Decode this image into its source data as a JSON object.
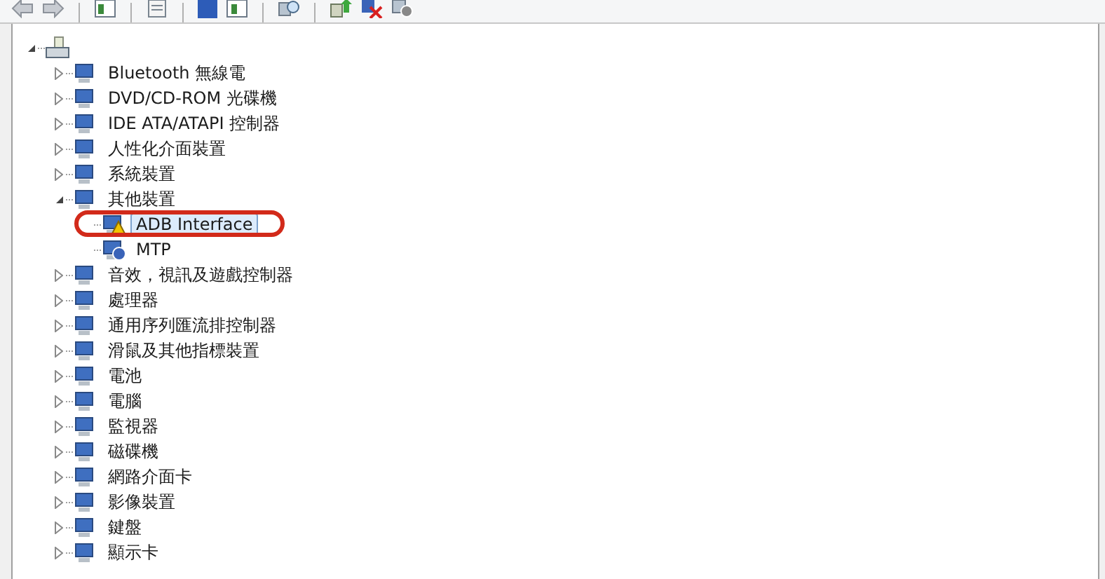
{
  "tree": {
    "expanded": true,
    "children": [
      {
        "label": "Bluetooth 無線電",
        "expanded": false,
        "selected": false
      },
      {
        "label": "DVD/CD-ROM 光碟機",
        "expanded": false,
        "selected": false
      },
      {
        "label": "IDE ATA/ATAPI 控制器",
        "expanded": false,
        "selected": false
      },
      {
        "label": "人性化介面裝置",
        "expanded": false,
        "selected": false
      },
      {
        "label": "系統裝置",
        "expanded": false,
        "selected": false
      },
      {
        "label": "其他裝置",
        "expanded": true,
        "selected": false,
        "children": [
          {
            "label": "ADB Interface",
            "selected": true,
            "warning": true,
            "circled": true
          },
          {
            "label": "MTP",
            "selected": false,
            "unknown": true
          }
        ]
      },
      {
        "label": "音效，視訊及遊戲控制器",
        "expanded": false,
        "selected": false
      },
      {
        "label": "處理器",
        "expanded": false,
        "selected": false
      },
      {
        "label": "通用序列匯流排控制器",
        "expanded": false,
        "selected": false
      },
      {
        "label": "滑鼠及其他指標裝置",
        "expanded": false,
        "selected": false
      },
      {
        "label": "電池",
        "expanded": false,
        "selected": false
      },
      {
        "label": "電腦",
        "expanded": false,
        "selected": false
      },
      {
        "label": "監視器",
        "expanded": false,
        "selected": false
      },
      {
        "label": "磁碟機",
        "expanded": false,
        "selected": false
      },
      {
        "label": "網路介面卡",
        "expanded": false,
        "selected": false
      },
      {
        "label": "影像裝置",
        "expanded": false,
        "selected": false
      },
      {
        "label": "鍵盤",
        "expanded": false,
        "selected": false
      },
      {
        "label": "顯示卡",
        "expanded": false,
        "selected": false
      }
    ]
  }
}
